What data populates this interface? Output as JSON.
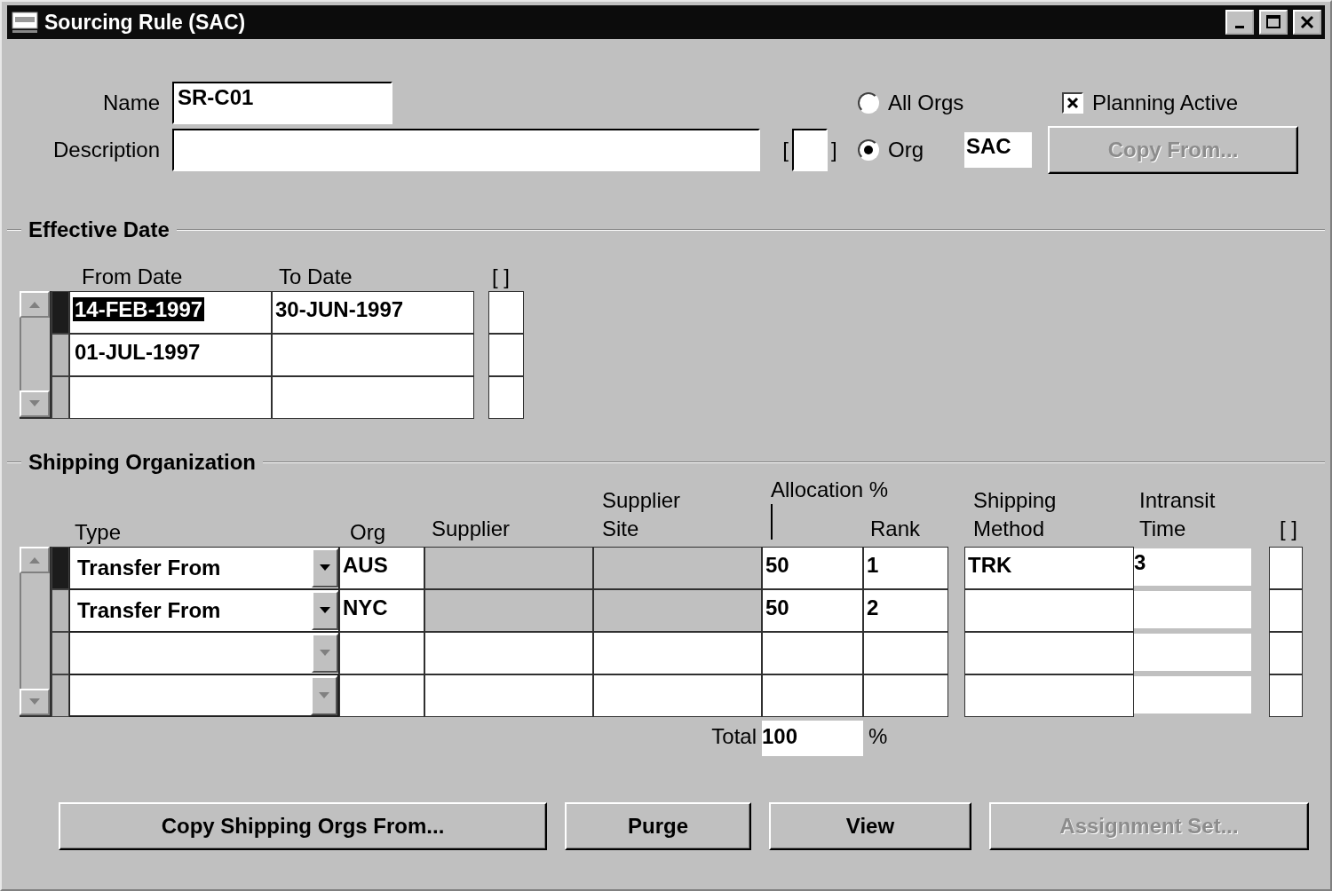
{
  "window": {
    "title": "Sourcing Rule (SAC)"
  },
  "header": {
    "name_label": "Name",
    "name_value": "SR-C01",
    "description_label": "Description",
    "flexfield": {
      "open": "[",
      "close": "]"
    },
    "org_options": [
      {
        "label": "All Orgs",
        "selected": false
      },
      {
        "label": "Org",
        "selected": true
      }
    ],
    "org_value": "SAC",
    "planning_active": {
      "label": "Planning Active",
      "checked": true
    },
    "copy_from": {
      "label": "Copy From...",
      "disabled": true
    }
  },
  "effective_date": {
    "title": "Effective Date",
    "columns": [
      "From Date",
      "To Date",
      "[ ]"
    ],
    "rows": [
      {
        "from_date": "14-FEB-1997",
        "to_date": "30-JUN-1997",
        "current": true,
        "highlighted": true
      },
      {
        "from_date": "01-JUL-1997",
        "current": false,
        "highlighted": false
      }
    ]
  },
  "shipping_organization": {
    "title": "Shipping Organization",
    "column_group": "Allocation %",
    "columns": [
      "Type",
      "Org",
      "Supplier",
      "Supplier Site",
      "Rank",
      "Shipping Method",
      "Intransit Time",
      "[ ]"
    ],
    "rows": [
      {
        "type": "Transfer From",
        "org": "AUS",
        "allocation": "50",
        "rank": "1",
        "shipping_method": "TRK",
        "intransit_time": "3",
        "current": true,
        "supplier_disabled": true
      },
      {
        "type": "Transfer From",
        "org": "NYC",
        "allocation": "50",
        "rank": "2",
        "current": false,
        "supplier_disabled": true
      }
    ],
    "total": {
      "label": "Total",
      "value": "100",
      "unit": "%"
    }
  },
  "buttons": [
    {
      "label": "Copy Shipping Orgs From...",
      "disabled": false
    },
    {
      "label": "Purge",
      "disabled": false
    },
    {
      "label": "View",
      "disabled": false
    },
    {
      "label": "Assignment Set...",
      "disabled": true
    }
  ]
}
